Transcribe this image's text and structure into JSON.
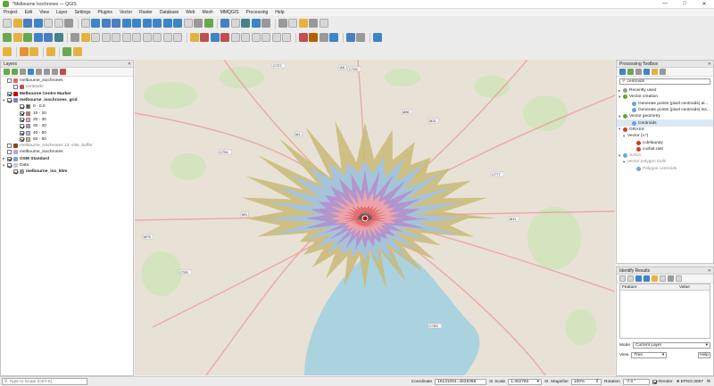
{
  "window": {
    "title": "*Melbourne Isochrones — QGIS",
    "controls": {
      "minimize": "—",
      "maximize": "□",
      "close": "✕"
    }
  },
  "menu": [
    "Project",
    "Edit",
    "View",
    "Layer",
    "Settings",
    "Plugins",
    "Vector",
    "Raster",
    "Database",
    "Web",
    "Mesh",
    "MMQGIS",
    "Processing",
    "Help"
  ],
  "layers_panel": {
    "title": "Layers",
    "items": [
      {
        "label": "melbourne_isochrones",
        "indent": 0,
        "checked": false,
        "arrow": "",
        "icon": "#e06666",
        "style": ""
      },
      {
        "label": "centroids",
        "indent": 1,
        "checked": false,
        "arrow": "",
        "icon": "#c0504d",
        "style": "ital"
      },
      {
        "label": "Melbourne Centre Marker",
        "indent": 0,
        "checked": true,
        "arrow": "",
        "icon": "#cc0000",
        "style": "bold"
      },
      {
        "label": "melbourne_isochrones_grid",
        "indent": 0,
        "checked": true,
        "arrow": "▾",
        "icon": "#7f7fbf",
        "style": "bold"
      },
      {
        "label": "0 - 0.0",
        "indent": 2,
        "checked": true,
        "arrow": "",
        "swatch": "#555555",
        "style": ""
      },
      {
        "label": "10 - 20",
        "indent": 2,
        "checked": true,
        "arrow": "",
        "swatch": "#e06666",
        "style": ""
      },
      {
        "label": "20 - 30",
        "indent": 2,
        "checked": true,
        "arrow": "",
        "swatch": "#f4a6a6",
        "style": ""
      },
      {
        "label": "30 - 40",
        "indent": 2,
        "checked": true,
        "arrow": "",
        "swatch": "#b48ec9",
        "style": ""
      },
      {
        "label": "40 - 50",
        "indent": 2,
        "checked": true,
        "arrow": "",
        "swatch": "#9fc5e8",
        "style": ""
      },
      {
        "label": "50 - 60",
        "indent": 2,
        "checked": true,
        "arrow": "",
        "swatch": "#c9b97a",
        "style": ""
      },
      {
        "label": "melbourne_isochrones 13_mile_buffer",
        "indent": 0,
        "checked": false,
        "arrow": "",
        "icon": "#8b4513",
        "style": "ital"
      },
      {
        "label": "melbourne_isochrones",
        "indent": 0,
        "checked": false,
        "arrow": "",
        "icon": "#b4a7d6",
        "style": ""
      },
      {
        "label": "OSM Standard",
        "indent": 0,
        "checked": true,
        "arrow": "▸",
        "icon": "#6fa8dc",
        "style": "bold"
      },
      {
        "label": "Data",
        "indent": 0,
        "checked": true,
        "arrow": "▾",
        "icon": "#cccccc",
        "style": ""
      },
      {
        "label": "melbourne_iso_50m",
        "indent": 1,
        "checked": true,
        "arrow": "",
        "icon": "#999999",
        "style": "bold"
      }
    ]
  },
  "processing_toolbox": {
    "title": "Processing Toolbox",
    "search_value": "centroids",
    "items": [
      {
        "label": "Recently used",
        "indent": 0,
        "arrow": "▸",
        "icon": "#999999",
        "style": ""
      },
      {
        "label": "Vector creation",
        "indent": 0,
        "arrow": "▾",
        "icon": "#5da832",
        "style": ""
      },
      {
        "label": "Generate points (pixel centroids) al...",
        "indent": 2,
        "arrow": "",
        "icon": "#6d9eeb",
        "style": ""
      },
      {
        "label": "Generate points (pixel centroids) ins...",
        "indent": 2,
        "arrow": "",
        "icon": "#6d9eeb",
        "style": ""
      },
      {
        "label": "Vector geometry",
        "indent": 0,
        "arrow": "▾",
        "icon": "#5da832",
        "style": ""
      },
      {
        "label": "Centroids",
        "indent": 2,
        "arrow": "",
        "icon": "#6d9eeb",
        "style": "sel"
      },
      {
        "label": "GRASS",
        "indent": 0,
        "arrow": "▾",
        "icon": "#cc4125",
        "style": ""
      },
      {
        "label": "Vector (v.*)",
        "indent": 1,
        "arrow": "▾",
        "icon": "",
        "style": ""
      },
      {
        "label": "v.delaunay",
        "indent": 3,
        "arrow": "",
        "icon": "#cc4125",
        "style": ""
      },
      {
        "label": "v.what.rast",
        "indent": 3,
        "arrow": "",
        "icon": "#cc4125",
        "style": ""
      },
      {
        "label": "SAGA",
        "indent": 0,
        "arrow": "▾",
        "icon": "#6fa8dc",
        "style": "dim"
      },
      {
        "label": "Vector polygon tools",
        "indent": 1,
        "arrow": "▾",
        "icon": "",
        "style": "dim"
      },
      {
        "label": "Polygon centroids",
        "indent": 3,
        "arrow": "",
        "icon": "#6fa8dc",
        "style": "dim"
      }
    ]
  },
  "identify_results": {
    "title": "Identify Results",
    "columns": [
      "Feature",
      "Value"
    ],
    "mode_label": "Mode",
    "mode_value": "Current Layer",
    "view_label": "View",
    "view_value": "Tree",
    "help_label": "Help"
  },
  "map": {
    "water": "#aad3df",
    "land": "#e8e2d6",
    "bands": [
      {
        "label": "50 - 60",
        "color": "#c9b97a"
      },
      {
        "label": "40 - 50",
        "color": "#9fc5e8"
      },
      {
        "label": "30 - 40",
        "color": "#b48ec9"
      },
      {
        "label": "20 - 30",
        "color": "#f4a6a6"
      },
      {
        "label": "10 - 20",
        "color": "#e06666"
      },
      {
        "label": "0 - 0.0",
        "color": "#555555"
      }
    ],
    "road_labels": [
      "C727",
      "C726",
      "M80",
      "M31",
      "C754",
      "M1",
      "M3",
      "A8",
      "C705",
      "M11",
      "C783",
      "C777",
      "M79"
    ]
  },
  "statusbar": {
    "locator_placeholder": "Type to locate (Ctrl+K)",
    "coordinate_label": "Coordinate",
    "coordinate_value": "16131064,-4528398",
    "scale_label": "Scale",
    "scale_value": "1:302783",
    "magnifier_label": "Magnifier",
    "magnifier_value": "100%",
    "rotation_label": "Rotation",
    "rotation_value": "-7.0 °",
    "render_label": "Render",
    "crs_value": "EPSG:3857"
  }
}
